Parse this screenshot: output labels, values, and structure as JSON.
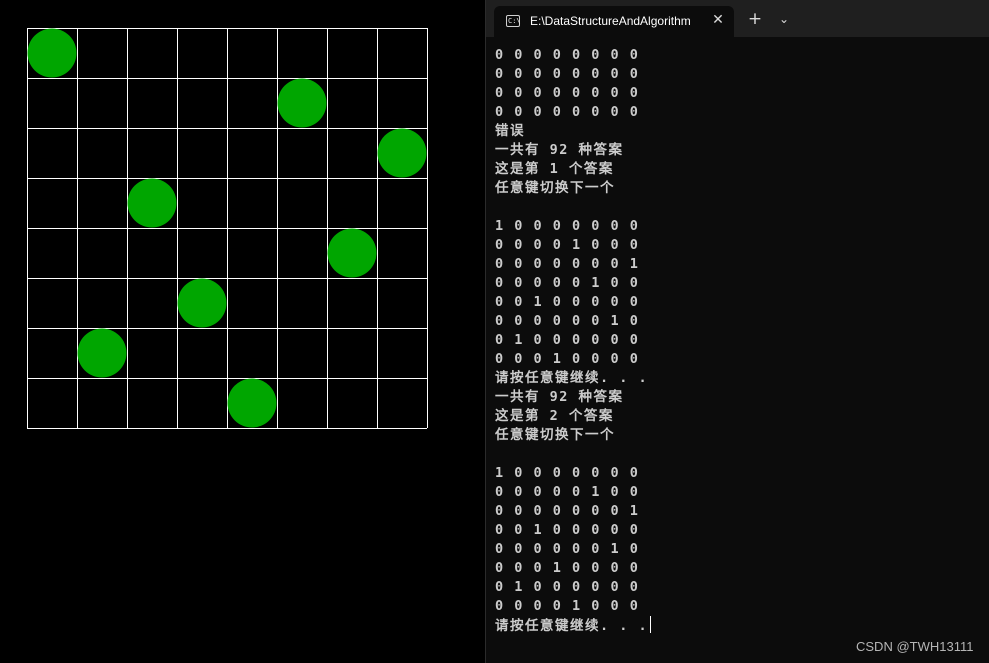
{
  "board": {
    "size": 8,
    "queen_cols_by_row": [
      0,
      5,
      7,
      2,
      6,
      3,
      1,
      4
    ],
    "line_color": "#ffffff",
    "queen_color": "#00a600",
    "background": "#000000"
  },
  "terminal": {
    "tab_title": "E:\\DataStructureAndAlgorithm",
    "tab_icon_text": "C:\\",
    "close_glyph": "✕",
    "new_tab_glyph": "+",
    "dropdown_glyph": "⌄",
    "lines": [
      "0 0 0 0 0 0 0 0",
      "0 0 0 0 0 0 0 0",
      "0 0 0 0 0 0 0 0",
      "0 0 0 0 0 0 0 0",
      "错误",
      "一共有 92 种答案",
      "这是第 1 个答案",
      "任意键切换下一个",
      "",
      "1 0 0 0 0 0 0 0",
      "0 0 0 0 1 0 0 0",
      "0 0 0 0 0 0 0 1",
      "0 0 0 0 0 1 0 0",
      "0 0 1 0 0 0 0 0",
      "0 0 0 0 0 0 1 0",
      "0 1 0 0 0 0 0 0",
      "0 0 0 1 0 0 0 0",
      "请按任意键继续. . .",
      "一共有 92 种答案",
      "这是第 2 个答案",
      "任意键切换下一个",
      "",
      "1 0 0 0 0 0 0 0",
      "0 0 0 0 0 1 0 0",
      "0 0 0 0 0 0 0 1",
      "0 0 1 0 0 0 0 0",
      "0 0 0 0 0 0 1 0",
      "0 0 0 1 0 0 0 0",
      "0 1 0 0 0 0 0 0",
      "0 0 0 0 1 0 0 0",
      "请按任意键继续. . ."
    ]
  },
  "watermark": "CSDN @TWH13111"
}
